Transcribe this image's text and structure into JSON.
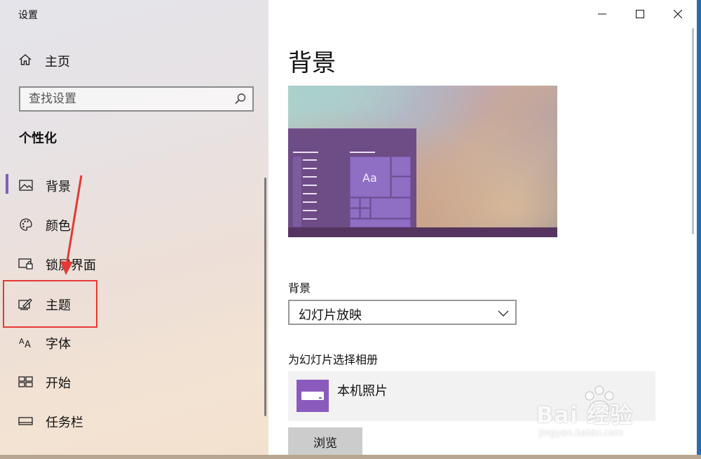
{
  "window": {
    "app_title": "设置",
    "controls": {
      "minimize": "minimize",
      "maximize": "maximize",
      "close": "close"
    }
  },
  "sidebar": {
    "home_label": "主页",
    "search_placeholder": "查找设置",
    "section_title": "个性化",
    "items": [
      {
        "label": "背景",
        "icon": "picture-icon",
        "active": true
      },
      {
        "label": "颜色",
        "icon": "palette-icon",
        "active": false
      },
      {
        "label": "锁屏界面",
        "icon": "lock-screen-icon",
        "active": false
      },
      {
        "label": "主题",
        "icon": "theme-brush-icon",
        "active": false
      },
      {
        "label": "字体",
        "icon": "font-icon",
        "active": false
      },
      {
        "label": "开始",
        "icon": "start-grid-icon",
        "active": false
      },
      {
        "label": "任务栏",
        "icon": "taskbar-icon",
        "active": false
      }
    ]
  },
  "main": {
    "page_title": "背景",
    "preview": {
      "sample_text": "Aa"
    },
    "background_label": "背景",
    "background_value": "幻灯片放映",
    "album_label": "为幻灯片选择相册",
    "album_name": "本机照片",
    "browse_label": "浏览"
  },
  "watermark": {
    "brand": "Bai 经验",
    "url": "jingyan.baidu.com"
  },
  "colors": {
    "accent": "#7b5fc2",
    "annotation_red": "#e53935",
    "preview_start_menu": "#6e4c86",
    "preview_tile": "#8f6fc3",
    "album_thumb": "#8a5bbd"
  }
}
